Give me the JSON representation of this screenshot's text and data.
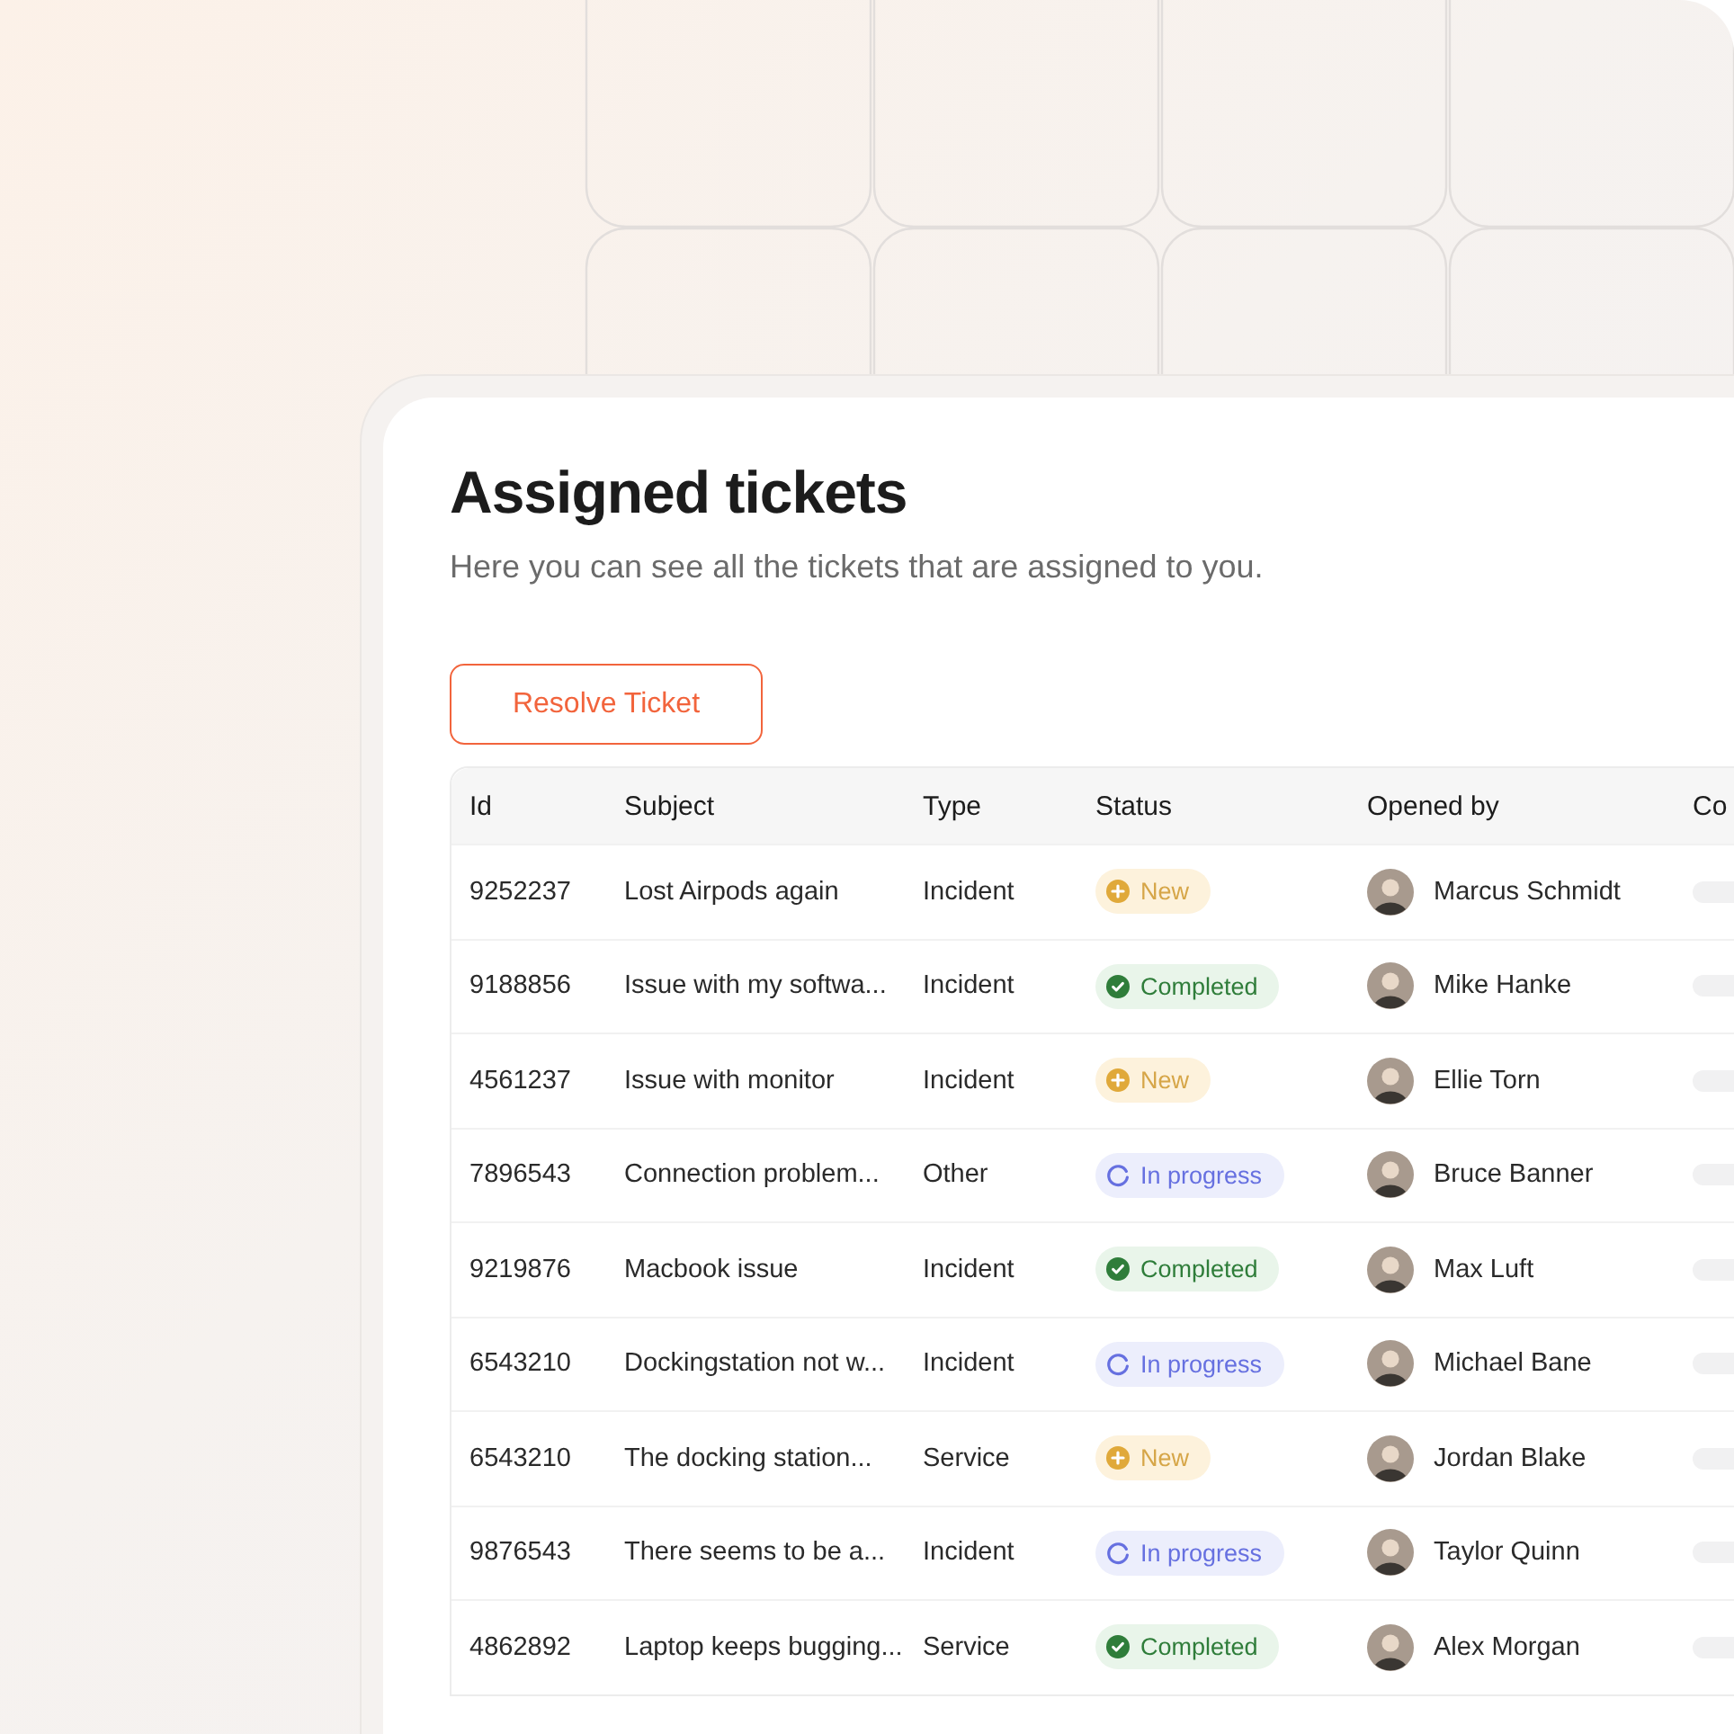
{
  "title": "Assigned tickets",
  "subtitle": "Here you can see all the tickets that are assigned to you.",
  "action_button": "Resolve Ticket",
  "table": {
    "columns": [
      "Id",
      "Subject",
      "Type",
      "Status",
      "Opened by",
      "Co"
    ],
    "rows": [
      {
        "id": "9252237",
        "subject": "Lost Airpods again",
        "type": "Incident",
        "status": {
          "label": "New",
          "kind": "new"
        },
        "opened_by": "Marcus Schmidt"
      },
      {
        "id": "9188856",
        "subject": "Issue with my softwa...",
        "type": "Incident",
        "status": {
          "label": "Completed",
          "kind": "completed"
        },
        "opened_by": "Mike Hanke"
      },
      {
        "id": "4561237",
        "subject": "Issue with monitor",
        "type": "Incident",
        "status": {
          "label": "New",
          "kind": "new"
        },
        "opened_by": "Ellie Torn"
      },
      {
        "id": "7896543",
        "subject": "Connection problem...",
        "type": "Other",
        "status": {
          "label": "In progress",
          "kind": "in_progress"
        },
        "opened_by": "Bruce Banner"
      },
      {
        "id": "9219876",
        "subject": "Macbook issue",
        "type": "Incident",
        "status": {
          "label": "Completed",
          "kind": "completed"
        },
        "opened_by": "Max Luft"
      },
      {
        "id": "6543210",
        "subject": "Dockingstation not w...",
        "type": "Incident",
        "status": {
          "label": "In progress",
          "kind": "in_progress"
        },
        "opened_by": "Michael Bane"
      },
      {
        "id": "6543210",
        "subject": "The docking station...",
        "type": "Service",
        "status": {
          "label": "New",
          "kind": "new"
        },
        "opened_by": "Jordan Blake"
      },
      {
        "id": "9876543",
        "subject": "There seems to be a...",
        "type": "Incident",
        "status": {
          "label": "In progress",
          "kind": "in_progress"
        },
        "opened_by": "Taylor Quinn"
      },
      {
        "id": "4862892",
        "subject": "Laptop keeps bugging...",
        "type": "Service",
        "status": {
          "label": "Completed",
          "kind": "completed"
        },
        "opened_by": "Alex Morgan"
      }
    ]
  }
}
